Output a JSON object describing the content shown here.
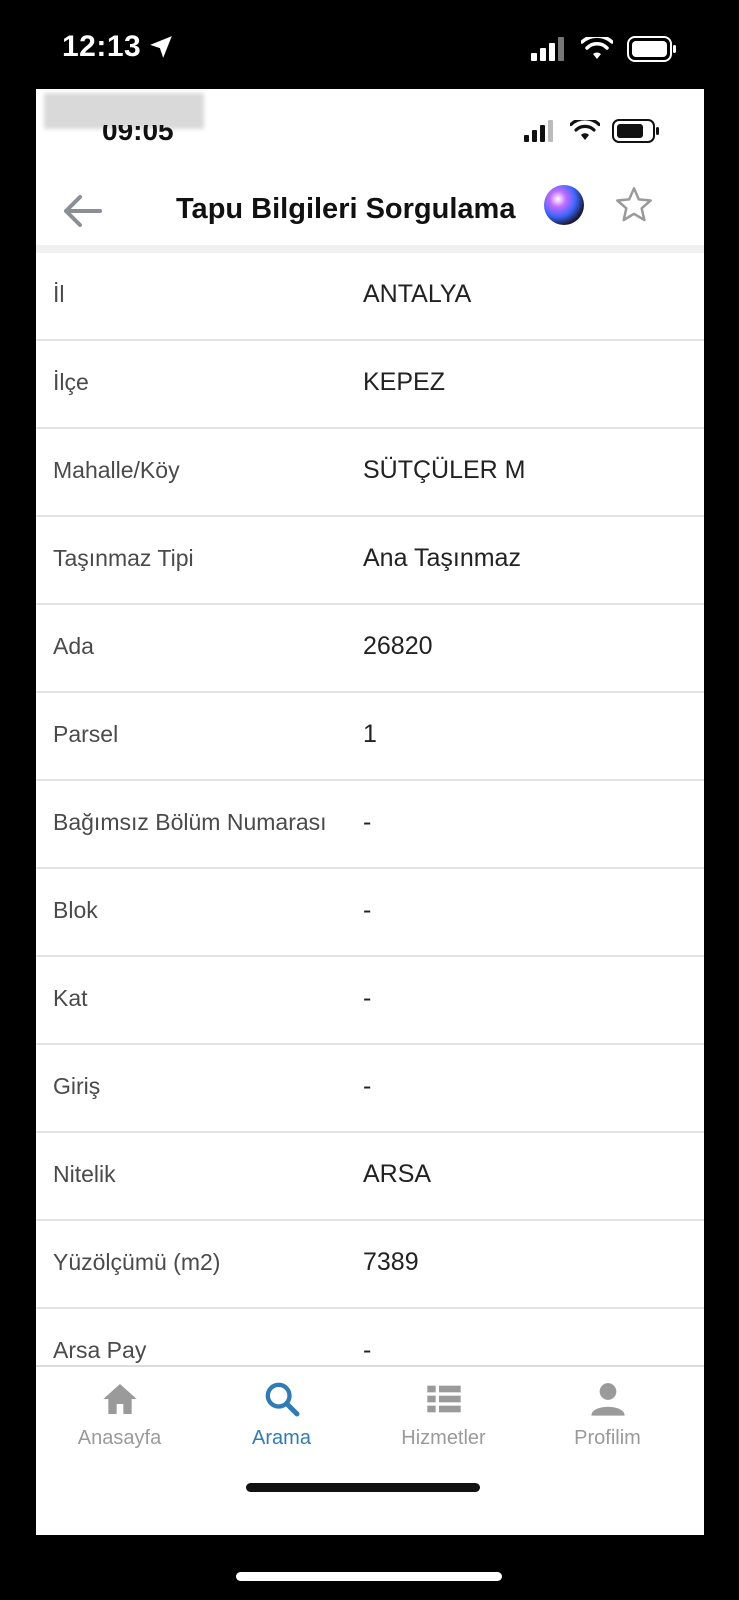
{
  "outer_status": {
    "time": "12:13"
  },
  "inner_status": {
    "time": "09:05"
  },
  "navbar": {
    "title": "Tapu Bilgileri Sorgulama"
  },
  "rows": [
    {
      "label": "İl",
      "value": "ANTALYA"
    },
    {
      "label": "İlçe",
      "value": "KEPEZ"
    },
    {
      "label": "Mahalle/Köy",
      "value": "SÜTÇÜLER M"
    },
    {
      "label": "Taşınmaz Tipi",
      "value": "Ana Taşınmaz"
    },
    {
      "label": "Ada",
      "value": "26820"
    },
    {
      "label": "Parsel",
      "value": "1"
    },
    {
      "label": "Bağımsız Bölüm Numarası",
      "value": "-"
    },
    {
      "label": "Blok",
      "value": "-"
    },
    {
      "label": "Kat",
      "value": "-"
    },
    {
      "label": "Giriş",
      "value": "-"
    },
    {
      "label": "Nitelik",
      "value": "ARSA"
    },
    {
      "label": "Yüzölçümü (m2)",
      "value": "7389"
    },
    {
      "label": "Arsa Pay",
      "value": "-"
    }
  ],
  "tabbar": {
    "tabs": [
      {
        "label": "Anasayfa",
        "icon": "home-icon",
        "active": false
      },
      {
        "label": "Arama",
        "icon": "search-icon",
        "active": true
      },
      {
        "label": "Hizmetler",
        "icon": "list-icon",
        "active": false
      },
      {
        "label": "Profilim",
        "icon": "user-icon",
        "active": false
      }
    ]
  },
  "colors": {
    "active_tab": "#2e7bb8",
    "inactive_tab": "#9a9a9a",
    "divider": "#e4e4e4"
  }
}
